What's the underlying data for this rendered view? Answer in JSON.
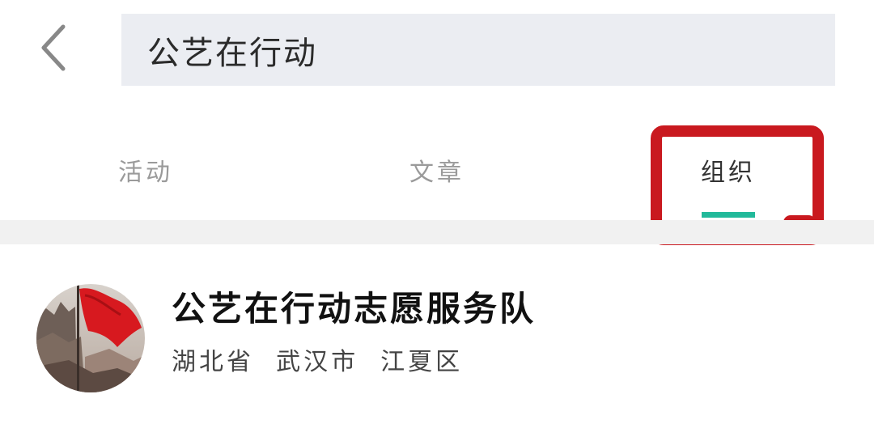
{
  "header": {
    "back_icon": "chevron-left-icon",
    "search_value": "公艺在行动"
  },
  "tabs": [
    {
      "label": "活动",
      "active": false
    },
    {
      "label": "文章",
      "active": false
    },
    {
      "label": "组织",
      "active": true
    }
  ],
  "colors": {
    "tab_indicator": "#21b99a",
    "annotation": "#c9191f",
    "search_bg": "#ebedf2"
  },
  "results": [
    {
      "name": "公艺在行动志愿服务队",
      "location": "湖北省  武汉市  江夏区",
      "avatar_icon": "red-flag-avatar"
    }
  ]
}
